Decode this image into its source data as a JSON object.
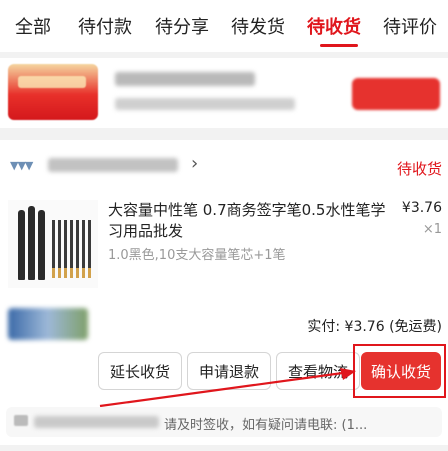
{
  "tabs": [
    {
      "label": "全部"
    },
    {
      "label": "待付款"
    },
    {
      "label": "待分享"
    },
    {
      "label": "待发货"
    },
    {
      "label": "待收货",
      "active": true
    },
    {
      "label": "待评价"
    }
  ],
  "order": {
    "status": "待收货",
    "product": {
      "title": "大容量中性笔 0.7商务签字笔0.5水性笔学习用品批发",
      "spec": "1.0黑色,10支大容量笔芯+1笔",
      "price": "¥3.76",
      "qty": "×1"
    },
    "paid": "实付: ¥3.76 (免运费)",
    "actions": {
      "extend": "延长收货",
      "refund": "申请退款",
      "logistics": "查看物流",
      "confirm": "确认收货"
    },
    "notice": "请及时签收，如有疑问请电联: (1..."
  },
  "colors": {
    "accent": "#e0161c",
    "primary_button": "#e6322e"
  },
  "icons": [
    "shop-icon",
    "chevron-right-icon",
    "truck-icon",
    "arrow-annotation"
  ]
}
